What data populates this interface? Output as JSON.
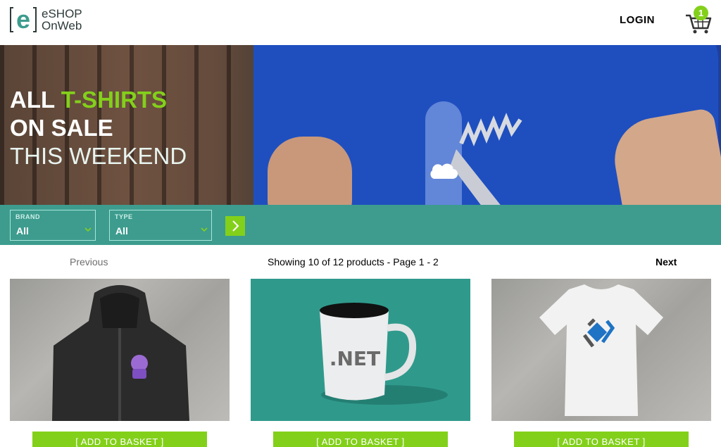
{
  "header": {
    "logo_line1": "eSHOP",
    "logo_line2": "OnWeb",
    "login_label": "LOGIN",
    "cart_count": "1"
  },
  "hero": {
    "line1_white": "ALL ",
    "line1_green": "T-SHIRTS",
    "line2": "ON SALE",
    "line3": "THIS WEEKEND"
  },
  "filters": {
    "brand": {
      "label": "BRAND",
      "value": "All"
    },
    "type": {
      "label": "TYPE",
      "value": "All"
    }
  },
  "pager": {
    "previous": "Previous",
    "info": "Showing 10 of 12 products - Page 1 - 2",
    "next": "Next"
  },
  "products": [
    {
      "add_label": "[ ADD TO BASKET ]",
      "image": "black-hoodie"
    },
    {
      "add_label": "[ ADD TO BASKET ]",
      "image": "dotnet-mug",
      "mug_text": ".NET"
    },
    {
      "add_label": "[ ADD TO BASKET ]",
      "image": "white-tshirt"
    }
  ],
  "colors": {
    "accent_green": "#83d01b",
    "teal": "#3d9c8e",
    "brand_blue": "#1f4fbf"
  }
}
